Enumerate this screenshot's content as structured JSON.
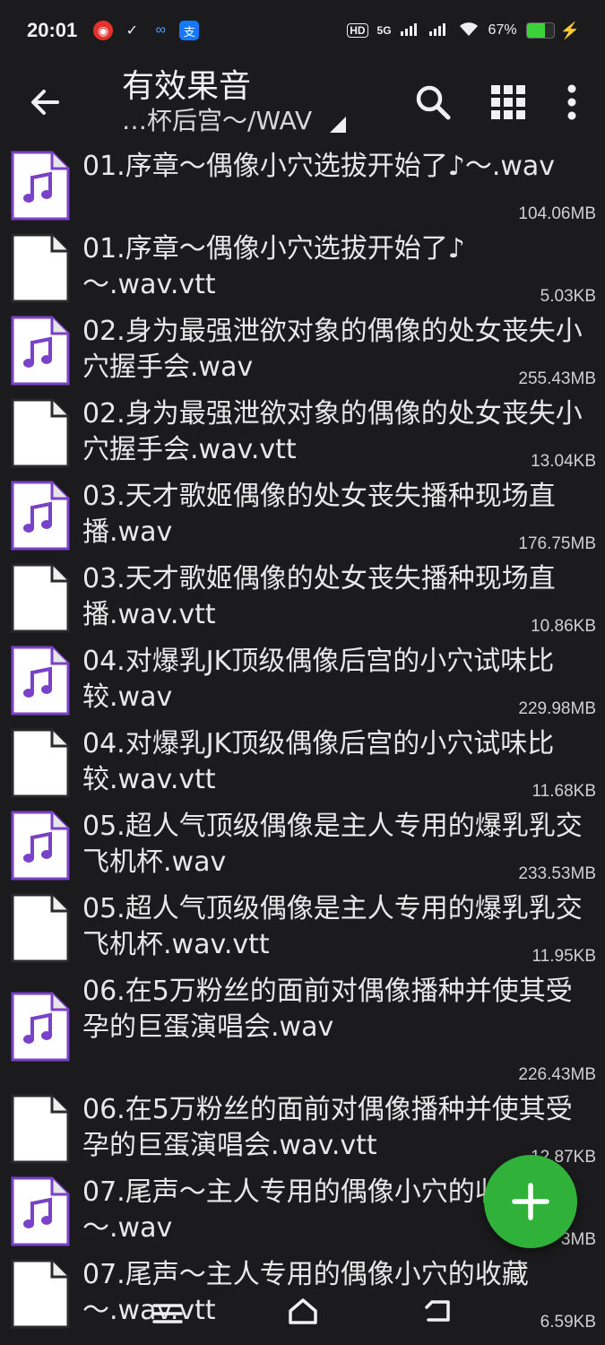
{
  "status": {
    "time": "20:01",
    "network": "5G",
    "battery": "67%",
    "battery_level": 0.67,
    "hd_label": "HD"
  },
  "appbar": {
    "title": "有效果音",
    "path": "…杯后宫～/WAV"
  },
  "files": [
    {
      "name": "01.序章～偶像小穴选拔开始了♪～.wav",
      "size": "104.06MB",
      "type": "audio",
      "height": 92
    },
    {
      "name": "01.序章～偶像小穴选拔开始了♪～.wav.vtt",
      "size": "5.03KB",
      "type": "text",
      "height": 92
    },
    {
      "name": "02.身为最强泄欲对象的偶像的处女丧失小穴握手会.wav",
      "size": "255.43MB",
      "type": "audio",
      "height": 92
    },
    {
      "name": "02.身为最强泄欲对象的偶像的处女丧失小穴握手会.wav.vtt",
      "size": "13.04KB",
      "type": "text",
      "height": 92
    },
    {
      "name": "03.天才歌姬偶像的处女丧失播种现场直播.wav",
      "size": "176.75MB",
      "type": "audio",
      "height": 92
    },
    {
      "name": "03.天才歌姬偶像的处女丧失播种现场直播.wav.vtt",
      "size": "10.86KB",
      "type": "text",
      "height": 92
    },
    {
      "name": "04.对爆乳JK顶级偶像后宫的小穴试味比较.wav",
      "size": "229.98MB",
      "type": "audio",
      "height": 92
    },
    {
      "name": "04.对爆乳JK顶级偶像后宫的小穴试味比较.wav.vtt",
      "size": "11.68KB",
      "type": "text",
      "height": 92
    },
    {
      "name": "05.超人气顶级偶像是主人专用的爆乳乳交飞机杯.wav",
      "size": "233.53MB",
      "type": "audio",
      "height": 92
    },
    {
      "name": "05.超人气顶级偶像是主人专用的爆乳乳交飞机杯.wav.vtt",
      "size": "11.95KB",
      "type": "text",
      "height": 92
    },
    {
      "name": "06.在5万粉丝的面前对偶像播种并使其受孕的巨蛋演唱会.wav",
      "size": "226.43MB",
      "type": "audio",
      "height": 132
    },
    {
      "name": "06.在5万粉丝的面前对偶像播种并使其受孕的巨蛋演唱会.wav.vtt",
      "size": "12.87KB",
      "type": "text",
      "height": 92
    },
    {
      "name": "07.尾声～主人专用的偶像小穴的收藏～.wav",
      "size": "3MB",
      "type": "audio",
      "height": 92
    },
    {
      "name": "07.尾声～主人专用的偶像小穴的收藏～.wav.vtt",
      "size": "6.59KB",
      "type": "text",
      "height": 92
    }
  ],
  "colors": {
    "background": "#1b1b1d",
    "audio_icon": "#7a42c9",
    "fab": "#30b23a"
  },
  "icons": {
    "back": "arrow-left-icon",
    "search": "search-icon",
    "grid": "grid-view-icon",
    "more": "more-vert-icon",
    "fab": "plus-icon"
  }
}
